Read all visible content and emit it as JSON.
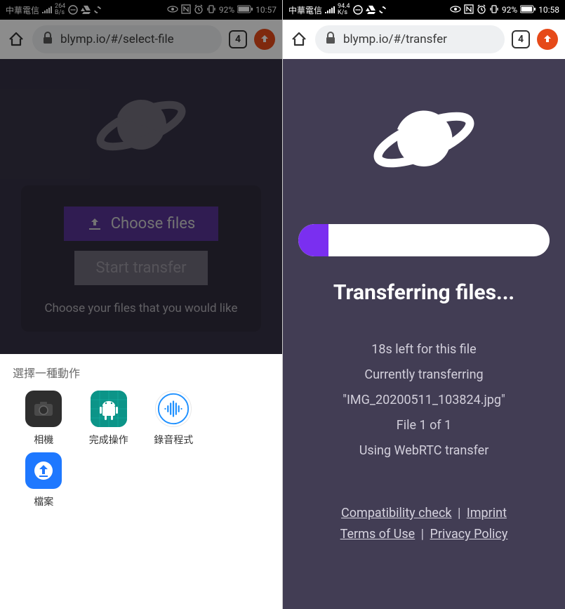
{
  "left": {
    "status": {
      "carrier": "中華電信",
      "speed_top": "264",
      "speed_bot": "B/s",
      "battery_pct": "92%",
      "time": "10:57"
    },
    "browser": {
      "url": "blymp.io/#/select-file",
      "tab_count": "4"
    },
    "page": {
      "choose_label": "Choose files",
      "start_label": "Start transfer",
      "helper": "Choose your files that you would like"
    },
    "sheet": {
      "title": "選擇一種動作",
      "items": [
        {
          "label": "相機"
        },
        {
          "label": "完成操作"
        },
        {
          "label": "錄音程式"
        },
        {
          "label": "檔案"
        }
      ]
    }
  },
  "right": {
    "status": {
      "carrier": "中華電信",
      "speed_top": "94.4",
      "speed_bot": "K/s",
      "battery_pct": "92%",
      "time": "10:58"
    },
    "browser": {
      "url": "blymp.io/#/transfer",
      "tab_count": "4"
    },
    "transfer": {
      "progress_pct": 12,
      "title": "Transferring files...",
      "eta": "18s left for this file",
      "currently": "Currently transferring",
      "filename": "\"IMG_20200511_103824.jpg\"",
      "count": "File 1 of 1",
      "method": "Using WebRTC transfer"
    },
    "footer": {
      "compat": "Compatibility check",
      "imprint": "Imprint",
      "terms": "Terms of Use",
      "privacy": "Privacy Policy"
    }
  }
}
